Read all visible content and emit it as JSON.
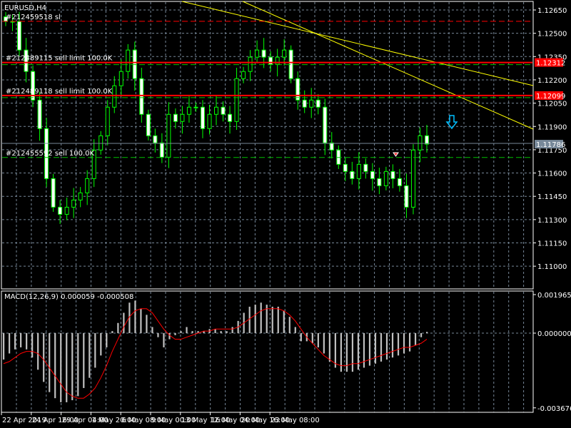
{
  "symbol_label": "EURUSD,H4",
  "orders": [
    {
      "label": "#212459518 sl",
      "price": 1.12577,
      "color": "#ff0000",
      "style": "dashed"
    },
    {
      "label": "#212489115 sell limit 100.0K",
      "price": 1.12312,
      "color": "#ff0000",
      "style": "solid"
    },
    {
      "label": "#212489118 sell limit 100.0K",
      "price": 1.12099,
      "color": "#ff0000",
      "style": "solid"
    },
    {
      "label": "#212455592 sell 100.0K",
      "price": 1.117,
      "color": "#00c000",
      "style": "dashed"
    }
  ],
  "price_tags": [
    {
      "label": "1.12312",
      "price": 1.12312,
      "color": "#ff0000"
    },
    {
      "label": "1.12099",
      "price": 1.12099,
      "color": "#ff0000"
    },
    {
      "label": "1.11786",
      "price": 1.11786,
      "color": "#778899"
    }
  ],
  "colors": {
    "candle": "#00ff00",
    "grid": "#778899",
    "trendline": "#ffff00",
    "signal": "#ff0000",
    "histogram": "#c0c0c0",
    "arrow": "#00bfff"
  },
  "chart_data": [
    {
      "type": "candlestick",
      "title": "EURUSD,H4",
      "ylim": [
        1.1093,
        1.1271
      ],
      "yticks": [
        "1.12650",
        "1.12500",
        "1.12350",
        "1.12200",
        "1.12050",
        "1.11900",
        "1.11750",
        "1.11600",
        "1.11450",
        "1.11300",
        "1.11150",
        "1.11000"
      ],
      "xticks": [
        "22 Apr 2019",
        "24 Apr 16:00",
        "29 Apr 04:00",
        "1 May 20:00",
        "6 May 08:00",
        "9 May 00:00",
        "13 May 12:00",
        "16 May 04:00",
        "20 May 16:00",
        "23 May 08:00"
      ],
      "closes": [
        1.12576,
        1.12576,
        1.12392,
        1.12254,
        1.1207,
        1.11886,
        1.11564,
        1.1138,
        1.11334,
        1.1138,
        1.11426,
        1.11472,
        1.11564,
        1.11748,
        1.1184,
        1.12024,
        1.12162,
        1.12254,
        1.12392,
        1.12208,
        1.11978,
        1.1184,
        1.11794,
        1.11702,
        1.11978,
        1.11932,
        1.11978,
        1.12024,
        1.12024,
        1.11886,
        1.11978,
        1.12024,
        1.11978,
        1.11932,
        1.12208,
        1.12254,
        1.12346,
        1.12392,
        1.12346,
        1.123,
        1.12346,
        1.12392,
        1.12208,
        1.1207,
        1.12024,
        1.1207,
        1.12024,
        1.11794,
        1.11748,
        1.11656,
        1.1161,
        1.11564,
        1.11656,
        1.1161,
        1.11564,
        1.11518,
        1.1161,
        1.11564,
        1.11518,
        1.1138,
        1.11748,
        1.1184,
        1.11786
      ]
    },
    {
      "type": "bar+line",
      "title": "MACD(12,26,9) 0.000059 -0.000508",
      "ylim": [
        -0.003676,
        0.001965
      ],
      "yticks": [
        "0.001965",
        "0.000000",
        "-0.003676"
      ],
      "histogram": [
        -0.0013,
        -0.001,
        -0.0008,
        -0.0007,
        -0.0008,
        -0.0012,
        -0.0018,
        -0.0024,
        -0.0029,
        -0.0032,
        -0.0034,
        -0.0034,
        -0.0033,
        -0.0031,
        -0.0027,
        -0.0022,
        -0.0017,
        -0.0011,
        -0.0007,
        0.0001,
        0.0005,
        0.001,
        0.0015,
        0.0016,
        0.0012,
        0.0009,
        0.0003,
        -0.0002,
        -0.0007,
        -0.0003,
        -0.0001,
        0.0001,
        0.0003,
        0.0001,
        0.0001,
        0.0001,
        0.0002,
        0.0002,
        0.0001,
        0.0001,
        0.0003,
        0.0006,
        0.001,
        0.0013,
        0.0014,
        0.0015,
        0.0014,
        0.0013,
        0.0013,
        0.0011,
        0.0008,
        0.0003,
        -0.0004,
        -0.0004,
        -0.0005,
        -0.0007,
        -0.001,
        -0.0014,
        -0.0017,
        -0.0019,
        -0.0019,
        -0.0019,
        -0.0018,
        -0.0017,
        -0.0016,
        -0.0015,
        -0.0014,
        -0.0013,
        -0.0012,
        -0.0011,
        -0.001,
        -0.0009,
        -0.0006,
        -0.0002,
        6e-05
      ],
      "signal": [
        -0.0015,
        -0.0014,
        -0.0012,
        -0.001,
        -0.0009,
        -0.0009,
        -0.001,
        -0.0013,
        -0.0017,
        -0.0021,
        -0.0025,
        -0.0029,
        -0.0031,
        -0.0032,
        -0.0032,
        -0.003,
        -0.0027,
        -0.0022,
        -0.0016,
        -0.0009,
        -0.0003,
        0.0003,
        0.0008,
        0.0011,
        0.0012,
        0.0012,
        0.001,
        0.0006,
        0.0002,
        -0.0001,
        -0.0003,
        -0.0003,
        -0.0002,
        -0.0001,
        0.0,
        0.0001,
        0.0001,
        0.0002,
        0.0002,
        0.0002,
        0.0002,
        0.0003,
        0.0005,
        0.0007,
        0.0009,
        0.0011,
        0.0012,
        0.0012,
        0.0012,
        0.0011,
        0.0009,
        0.0006,
        0.0002,
        -0.0002,
        -0.0005,
        -0.0008,
        -0.0011,
        -0.0013,
        -0.0015,
        -0.0016,
        -0.0016,
        -0.0015,
        -0.0015,
        -0.0014,
        -0.0013,
        -0.0012,
        -0.0011,
        -0.001,
        -0.0009,
        -0.0008,
        -0.0007,
        -0.0007,
        -0.0006,
        -0.0005,
        -0.0003
      ]
    }
  ]
}
